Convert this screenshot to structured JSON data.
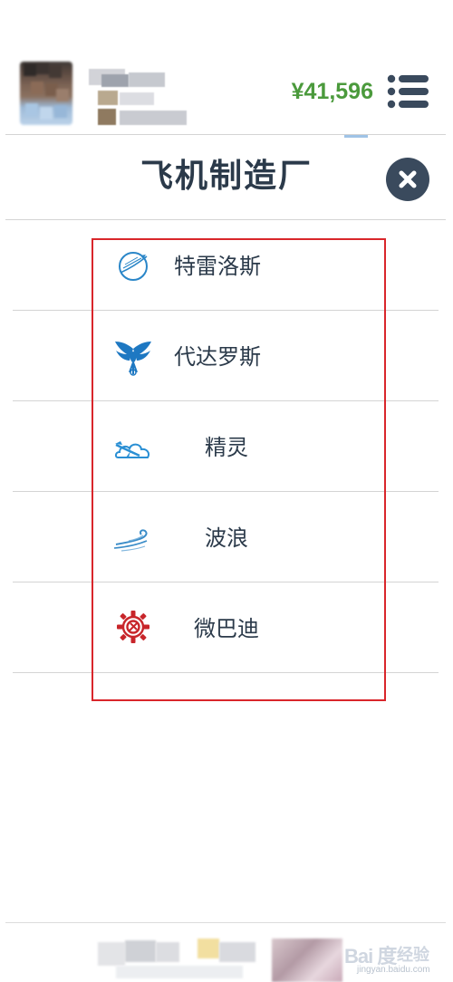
{
  "header": {
    "balance": "¥41,596",
    "menu_icon": "hamburger-menu-icon",
    "avatar_icon": "user-avatar"
  },
  "title": {
    "text": "飞机制造厂",
    "close_icon": "close-icon"
  },
  "manufacturers": [
    {
      "label": "特雷洛斯",
      "icon": "jet-planet-icon",
      "color": "#2a86c8"
    },
    {
      "label": "代达罗斯",
      "icon": "winged-phoenix-icon",
      "color": "#1e78c2"
    },
    {
      "label": "精灵",
      "icon": "cloud-plane-icon",
      "color": "#2a8fd4"
    },
    {
      "label": "波浪",
      "icon": "wave-icon",
      "color": "#3a8cc8"
    },
    {
      "label": "微巴迪",
      "icon": "gear-wrench-icon",
      "color": "#c8252a"
    }
  ],
  "highlight": {
    "color": "#d9262b"
  },
  "footer": {
    "watermark_logo": "Bai 度",
    "watermark_text": "经验",
    "watermark_url": "jingyan.baidu.com"
  },
  "colors": {
    "balance_green": "#4b9a3c",
    "title_dark": "#2b3a4a",
    "close_bg": "#3a4a5d",
    "divider": "#d4d4d4"
  }
}
